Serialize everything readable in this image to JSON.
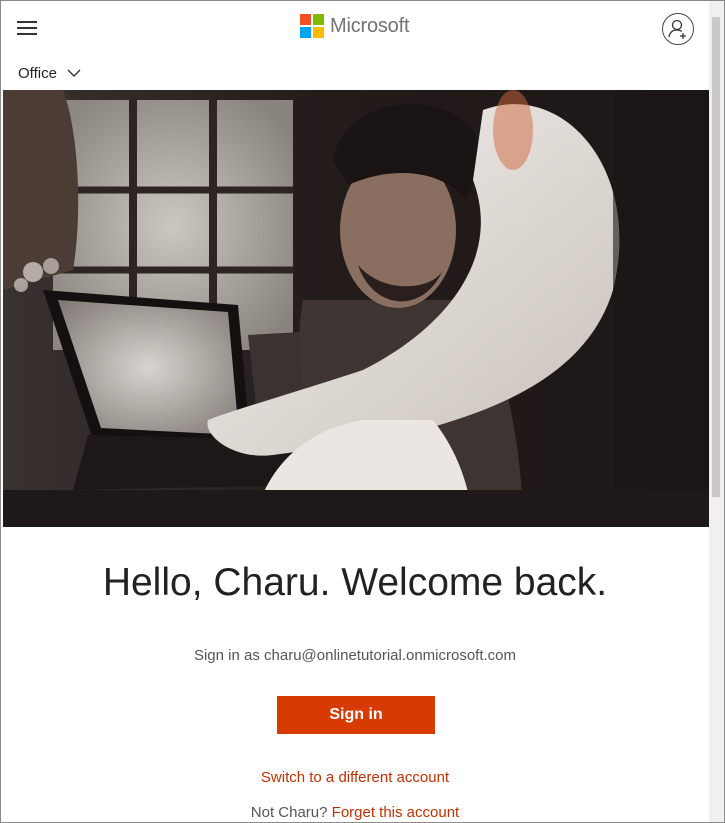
{
  "header": {
    "brand_name": "Microsoft",
    "product_menu_label": "Office",
    "menu_icon": "hamburger-icon",
    "account_icon": "add-account-icon",
    "logo_colors": [
      "#f25022",
      "#7fba00",
      "#00a4ef",
      "#ffb900"
    ]
  },
  "hero": {
    "description_icon": "hero-photo"
  },
  "main": {
    "welcome_heading": "Hello, Charu. Welcome back.",
    "signin_as_prefix": "Sign in as",
    "email": "charu@onlinetutorial.onmicrosoft.com",
    "signin_button_label": "Sign in",
    "switch_account_link": "Switch to a different account",
    "not_user_prefix": "Not Charu?",
    "forget_account_link": "Forget this account"
  },
  "colors": {
    "accent": "#d83b01",
    "link": "#c13100",
    "text": "#222222",
    "muted_text": "#555555"
  }
}
